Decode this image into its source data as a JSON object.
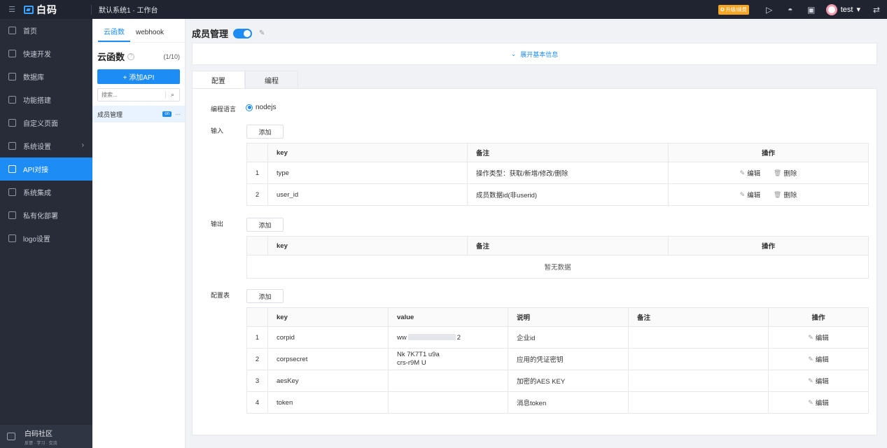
{
  "topbar": {
    "logo_text": "白码",
    "breadcrumb": "默认系统1 · 工作台",
    "upgrade_label": "升级/续费",
    "user_name": "test"
  },
  "sidebar": {
    "items": [
      {
        "label": "首页",
        "icon": "home-icon"
      },
      {
        "label": "快速开发",
        "icon": "cube-icon"
      },
      {
        "label": "数据库",
        "icon": "database-icon"
      },
      {
        "label": "功能搭建",
        "icon": "build-icon"
      },
      {
        "label": "自定义页面",
        "icon": "page-icon"
      },
      {
        "label": "系统设置",
        "icon": "settings-icon"
      },
      {
        "label": "API对接",
        "icon": "api-icon"
      },
      {
        "label": "系统集成",
        "icon": "layers-icon"
      },
      {
        "label": "私有化部署",
        "icon": "server-icon"
      },
      {
        "label": "logo设置",
        "icon": "logo-icon"
      }
    ],
    "active_index": 6,
    "footer": {
      "title": "白码社区",
      "subtitle": "反馈 · 学习 · 交流"
    }
  },
  "fnpanel": {
    "tabs": [
      "云函数",
      "webhook"
    ],
    "title": "云函数",
    "count": "(1/10)",
    "add_label": "+ 添加API",
    "search_placeholder": "搜索...",
    "items": [
      {
        "label": "成员管理",
        "badge": "on"
      }
    ]
  },
  "main": {
    "title": "成员管理",
    "enabled": true,
    "expand_label": "展开基本信息",
    "tabs": [
      "配置",
      "编程"
    ],
    "lang_label": "编程语言",
    "lang_value": "nodejs",
    "add_label": "添加",
    "input": {
      "label": "输入",
      "headers": [
        "key",
        "备注",
        "操作"
      ],
      "rows": [
        {
          "idx": "1",
          "key": "type",
          "note": "操作类型：获取/新增/修改/删除"
        },
        {
          "idx": "2",
          "key": "user_id",
          "note": "成员数据id(非userid)"
        }
      ]
    },
    "output": {
      "label": "输出",
      "headers": [
        "key",
        "备注",
        "操作"
      ],
      "empty_text": "暂无数据"
    },
    "config": {
      "label": "配置表",
      "headers": [
        "key",
        "value",
        "说明",
        "备注",
        "操作"
      ],
      "rows": [
        {
          "idx": "1",
          "key": "corpid",
          "value_prefix": "ww",
          "value_suffix": "2",
          "desc": "企业id"
        },
        {
          "idx": "2",
          "key": "corpsecret",
          "value_line1": "Nk    7K7T1                    u9a",
          "value_line2": "crs-r9M              U",
          "desc": "应用的凭证密钥"
        },
        {
          "idx": "3",
          "key": "aesKey",
          "desc": "加密的AES KEY"
        },
        {
          "idx": "4",
          "key": "token",
          "desc": "消息token"
        }
      ]
    },
    "edit_label": "编辑",
    "delete_label": "删除"
  }
}
